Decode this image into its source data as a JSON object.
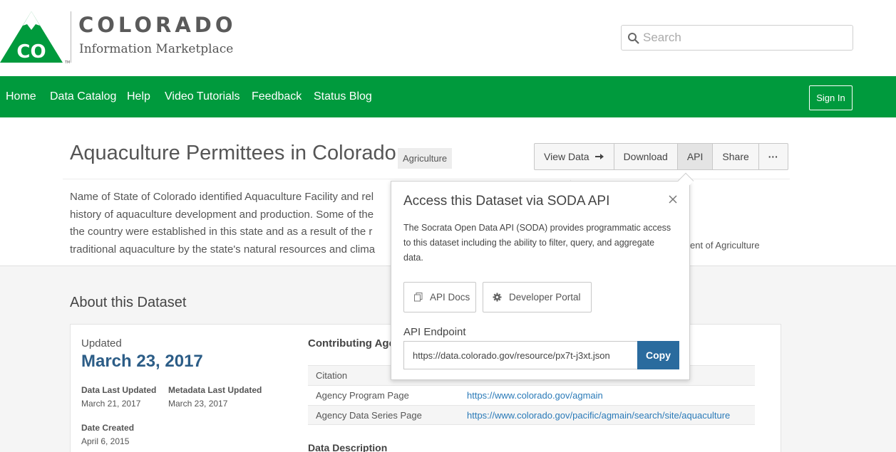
{
  "header": {
    "logo_letters": "CO",
    "logo_title": "COLORADO",
    "logo_subtitle": "Information Marketplace",
    "search_placeholder": "Search"
  },
  "nav": {
    "items": [
      "Home",
      "Data Catalog",
      "Help",
      "Video Tutorials",
      "Feedback",
      "Status Blog"
    ],
    "sign_in": "Sign In",
    "color": "#009a3d"
  },
  "dataset": {
    "title": "Aquaculture Permittees in Colorado",
    "category": "Agriculture",
    "actions": {
      "view_data": "View Data",
      "download": "Download",
      "api": "API",
      "share": "Share",
      "more": "···"
    },
    "description_lines": [
      "Name of State of Colorado identified Aquaculture Facility and rel",
      "history of aquaculture development and production. Some of the",
      "the country were established in this state and as a result of the r",
      "traditional aquaculture by the state's natural resources and clima"
    ],
    "right_info": "ent of Agriculture"
  },
  "about": {
    "heading": "About this Dataset",
    "updated_label": "Updated",
    "updated_date": "March 23, 2017",
    "data_last_updated_label": "Data Last Updated",
    "data_last_updated": "March 21, 2017",
    "metadata_last_updated_label": "Metadata Last Updated",
    "metadata_last_updated": "March 23, 2017",
    "date_created_label": "Date Created",
    "date_created": "April 6, 2015",
    "contributing_label": "Contributing Ager",
    "rows": [
      {
        "label": "Citation",
        "value": ""
      },
      {
        "label": "Agency Program Page",
        "value": "https://www.colorado.gov/agmain"
      },
      {
        "label": "Agency Data Series Page",
        "value": "https://www.colorado.gov/pacific/agmain/search/site/aquaculture"
      }
    ],
    "data_description_label": "Data Description"
  },
  "api_popover": {
    "title": "Access this Dataset via SODA API",
    "text": "The Socrata Open Data API (SODA) provides programmatic access to this dataset including the ability to filter, query, and aggregate data.",
    "api_docs": "API Docs",
    "developer_portal": "Developer Portal",
    "endpoint_label": "API Endpoint",
    "endpoint_url": "https://data.colorado.gov/resource/px7t-j3xt.json",
    "copy": "Copy",
    "copy_color": "#2a6b9e"
  }
}
